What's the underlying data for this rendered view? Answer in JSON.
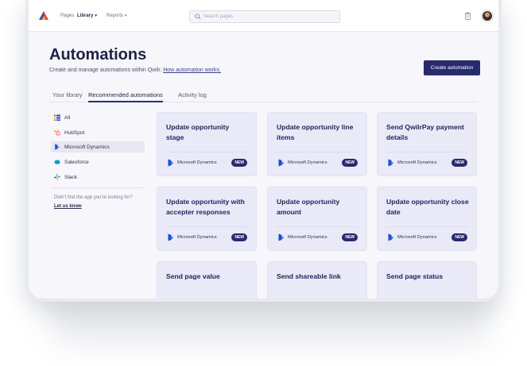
{
  "nav": {
    "pages": "Pages",
    "library": "Library",
    "reports": "Reports",
    "search_placeholder": "Search pages"
  },
  "header": {
    "title": "Automations",
    "subtitle": "Create and manage automations within Qwilr.",
    "help_link": "How automation works.",
    "create_button": "Create automation"
  },
  "tabs": [
    "Your library",
    "Recommended automations",
    "Activity log"
  ],
  "active_tab": "Recommended automations",
  "sidebar": {
    "items": [
      {
        "label": "All",
        "icon": "grid-list-icon"
      },
      {
        "label": "HubSpot",
        "icon": "hubspot-icon"
      },
      {
        "label": "Microsoft Dynamics",
        "icon": "microsoft-dynamics-icon"
      },
      {
        "label": "Salesforce",
        "icon": "salesforce-icon"
      },
      {
        "label": "Slack",
        "icon": "slack-icon"
      }
    ],
    "selected": "Microsoft Dynamics",
    "help_text": "Didn't find the app you're looking for?",
    "help_link": "Let us know"
  },
  "cards": [
    {
      "title": "Update opportunity stage",
      "app": "Microsoft Dynamics",
      "badge": "NEW"
    },
    {
      "title": "Update opportunity line items",
      "app": "Microsoft Dynamics",
      "badge": "NEW"
    },
    {
      "title": "Send QwilrPay payment details",
      "app": "Microsoft Dynamics",
      "badge": "NEW"
    },
    {
      "title": "Update opportunity with accepter responses",
      "app": "Microsoft Dynamics",
      "badge": "NEW"
    },
    {
      "title": "Update opportunity amount",
      "app": "Microsoft Dynamics",
      "badge": "NEW"
    },
    {
      "title": "Update opportunity close date",
      "app": "Microsoft Dynamics",
      "badge": "NEW"
    },
    {
      "title": "Send page value"
    },
    {
      "title": "Send shareable link"
    },
    {
      "title": "Send page status"
    }
  ],
  "colors": {
    "primary": "#282a6e",
    "card_bg": "#e9e9f8",
    "title_text": "#1f2147"
  }
}
